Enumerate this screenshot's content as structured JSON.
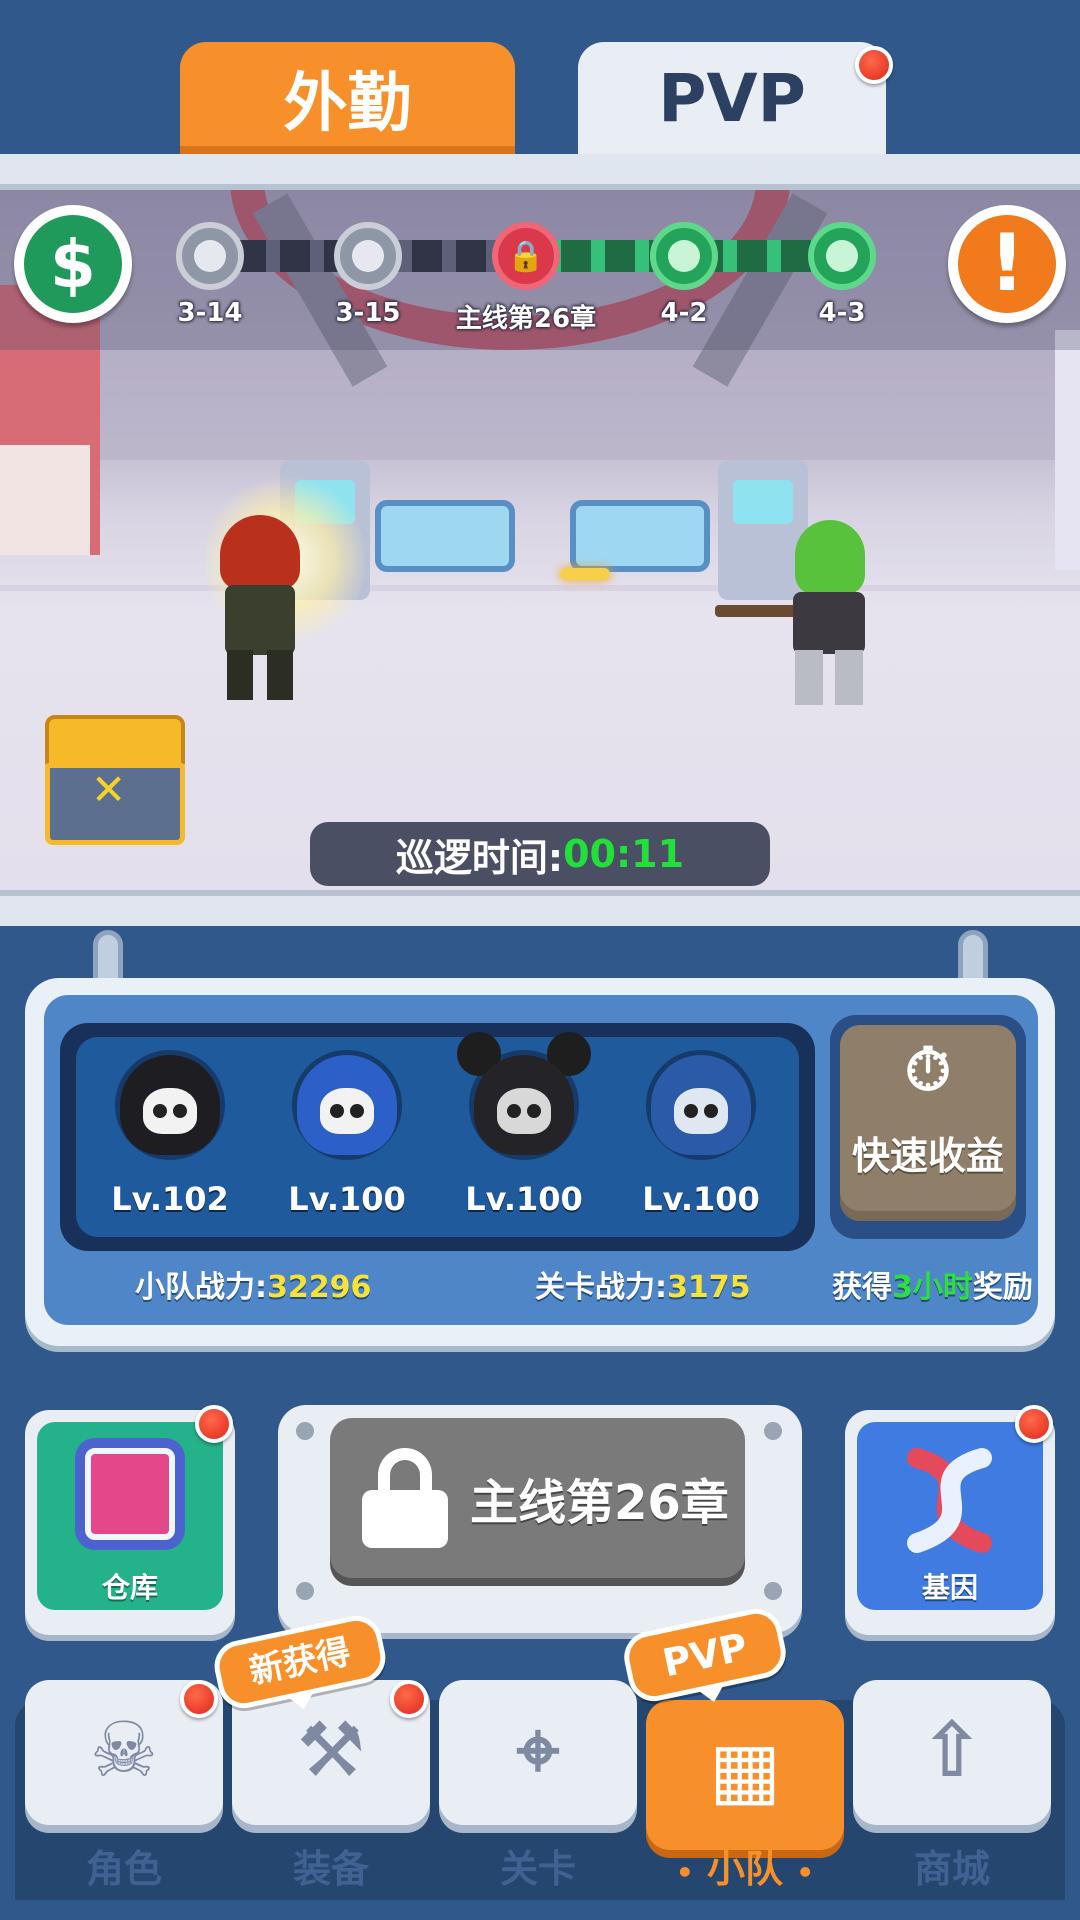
{
  "top_tabs": {
    "patrol_tab": "外勤",
    "pvp_tab": "PVP"
  },
  "stage_progress": {
    "nodes": [
      {
        "label": "3-14",
        "state": "done"
      },
      {
        "label": "3-15",
        "state": "done"
      },
      {
        "label": "主线第26章",
        "state": "locked"
      },
      {
        "label": "4-2",
        "state": "open"
      },
      {
        "label": "4-3",
        "state": "open"
      }
    ],
    "lock_glyph": "🔒",
    "dollar_icon": "$",
    "alert_icon": "!"
  },
  "patrol": {
    "label": "巡逻时间:",
    "time": "00:11"
  },
  "chest_mark": "✕",
  "squad": {
    "heroes": [
      {
        "level": "Lv.102",
        "hood_color": "#1d1d22"
      },
      {
        "level": "Lv.100",
        "hood_color": "#2c5fc8"
      },
      {
        "level": "Lv.100",
        "hood_color": "#242428"
      },
      {
        "level": "Lv.100",
        "hood_color": "#2a5aa8"
      }
    ],
    "quick_reward": {
      "icon_glyph": "⏱",
      "label": "快速收益"
    },
    "team_power_label": "小队战力:",
    "team_power_value": "32296",
    "stage_power_label": "关卡战力:",
    "stage_power_value": "3175",
    "reward_prefix": "获得",
    "reward_hours": "3小时",
    "reward_suffix": "奖励"
  },
  "actions": {
    "warehouse_label": "仓库",
    "main_button_label": "主线第26章",
    "gene_label": "基因"
  },
  "bottom_nav": {
    "items": [
      {
        "label": "角色",
        "icon": "☠"
      },
      {
        "label": "装备",
        "icon": "⚒"
      },
      {
        "label": "关卡",
        "icon": "⌖"
      },
      {
        "label": "小队",
        "icon": "▦"
      },
      {
        "label": "商城",
        "icon": "⇧"
      }
    ],
    "new_badge": "新获得",
    "pvp_badge": "PVP",
    "active_prefix": "•",
    "active_suffix": "•"
  },
  "colors": {
    "accent_orange": "#f7902a",
    "panel_blue": "#4f86c8",
    "power_yellow": "#f7e23a",
    "highlight_green": "#2ee03c",
    "badge_red": "#e0271a"
  }
}
